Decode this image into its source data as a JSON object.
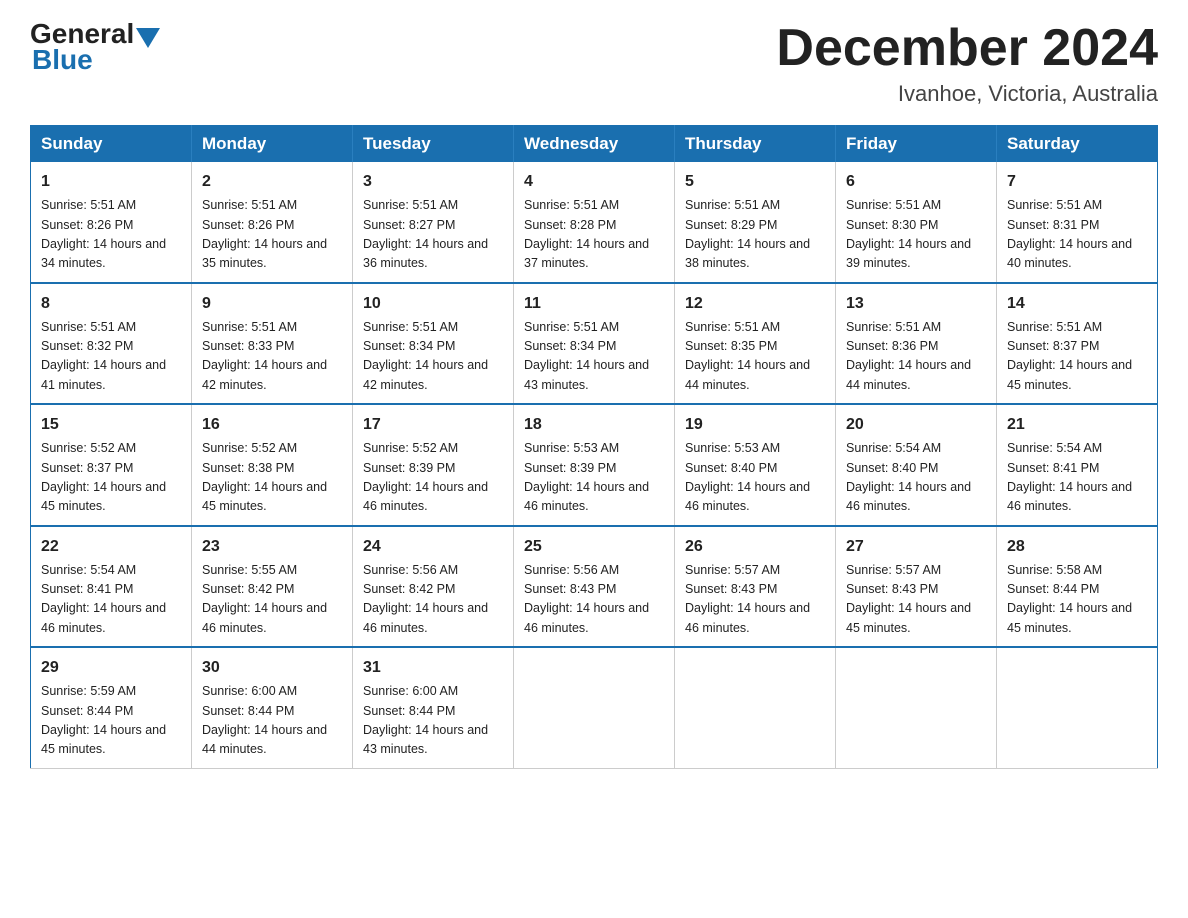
{
  "logo": {
    "general": "General",
    "blue": "Blue"
  },
  "title": "December 2024",
  "subtitle": "Ivanhoe, Victoria, Australia",
  "days_of_week": [
    "Sunday",
    "Monday",
    "Tuesday",
    "Wednesday",
    "Thursday",
    "Friday",
    "Saturday"
  ],
  "weeks": [
    [
      {
        "day": "1",
        "sunrise": "5:51 AM",
        "sunset": "8:26 PM",
        "daylight": "14 hours and 34 minutes."
      },
      {
        "day": "2",
        "sunrise": "5:51 AM",
        "sunset": "8:26 PM",
        "daylight": "14 hours and 35 minutes."
      },
      {
        "day": "3",
        "sunrise": "5:51 AM",
        "sunset": "8:27 PM",
        "daylight": "14 hours and 36 minutes."
      },
      {
        "day": "4",
        "sunrise": "5:51 AM",
        "sunset": "8:28 PM",
        "daylight": "14 hours and 37 minutes."
      },
      {
        "day": "5",
        "sunrise": "5:51 AM",
        "sunset": "8:29 PM",
        "daylight": "14 hours and 38 minutes."
      },
      {
        "day": "6",
        "sunrise": "5:51 AM",
        "sunset": "8:30 PM",
        "daylight": "14 hours and 39 minutes."
      },
      {
        "day": "7",
        "sunrise": "5:51 AM",
        "sunset": "8:31 PM",
        "daylight": "14 hours and 40 minutes."
      }
    ],
    [
      {
        "day": "8",
        "sunrise": "5:51 AM",
        "sunset": "8:32 PM",
        "daylight": "14 hours and 41 minutes."
      },
      {
        "day": "9",
        "sunrise": "5:51 AM",
        "sunset": "8:33 PM",
        "daylight": "14 hours and 42 minutes."
      },
      {
        "day": "10",
        "sunrise": "5:51 AM",
        "sunset": "8:34 PM",
        "daylight": "14 hours and 42 minutes."
      },
      {
        "day": "11",
        "sunrise": "5:51 AM",
        "sunset": "8:34 PM",
        "daylight": "14 hours and 43 minutes."
      },
      {
        "day": "12",
        "sunrise": "5:51 AM",
        "sunset": "8:35 PM",
        "daylight": "14 hours and 44 minutes."
      },
      {
        "day": "13",
        "sunrise": "5:51 AM",
        "sunset": "8:36 PM",
        "daylight": "14 hours and 44 minutes."
      },
      {
        "day": "14",
        "sunrise": "5:51 AM",
        "sunset": "8:37 PM",
        "daylight": "14 hours and 45 minutes."
      }
    ],
    [
      {
        "day": "15",
        "sunrise": "5:52 AM",
        "sunset": "8:37 PM",
        "daylight": "14 hours and 45 minutes."
      },
      {
        "day": "16",
        "sunrise": "5:52 AM",
        "sunset": "8:38 PM",
        "daylight": "14 hours and 45 minutes."
      },
      {
        "day": "17",
        "sunrise": "5:52 AM",
        "sunset": "8:39 PM",
        "daylight": "14 hours and 46 minutes."
      },
      {
        "day": "18",
        "sunrise": "5:53 AM",
        "sunset": "8:39 PM",
        "daylight": "14 hours and 46 minutes."
      },
      {
        "day": "19",
        "sunrise": "5:53 AM",
        "sunset": "8:40 PM",
        "daylight": "14 hours and 46 minutes."
      },
      {
        "day": "20",
        "sunrise": "5:54 AM",
        "sunset": "8:40 PM",
        "daylight": "14 hours and 46 minutes."
      },
      {
        "day": "21",
        "sunrise": "5:54 AM",
        "sunset": "8:41 PM",
        "daylight": "14 hours and 46 minutes."
      }
    ],
    [
      {
        "day": "22",
        "sunrise": "5:54 AM",
        "sunset": "8:41 PM",
        "daylight": "14 hours and 46 minutes."
      },
      {
        "day": "23",
        "sunrise": "5:55 AM",
        "sunset": "8:42 PM",
        "daylight": "14 hours and 46 minutes."
      },
      {
        "day": "24",
        "sunrise": "5:56 AM",
        "sunset": "8:42 PM",
        "daylight": "14 hours and 46 minutes."
      },
      {
        "day": "25",
        "sunrise": "5:56 AM",
        "sunset": "8:43 PM",
        "daylight": "14 hours and 46 minutes."
      },
      {
        "day": "26",
        "sunrise": "5:57 AM",
        "sunset": "8:43 PM",
        "daylight": "14 hours and 46 minutes."
      },
      {
        "day": "27",
        "sunrise": "5:57 AM",
        "sunset": "8:43 PM",
        "daylight": "14 hours and 45 minutes."
      },
      {
        "day": "28",
        "sunrise": "5:58 AM",
        "sunset": "8:44 PM",
        "daylight": "14 hours and 45 minutes."
      }
    ],
    [
      {
        "day": "29",
        "sunrise": "5:59 AM",
        "sunset": "8:44 PM",
        "daylight": "14 hours and 45 minutes."
      },
      {
        "day": "30",
        "sunrise": "6:00 AM",
        "sunset": "8:44 PM",
        "daylight": "14 hours and 44 minutes."
      },
      {
        "day": "31",
        "sunrise": "6:00 AM",
        "sunset": "8:44 PM",
        "daylight": "14 hours and 43 minutes."
      },
      null,
      null,
      null,
      null
    ]
  ],
  "labels": {
    "sunrise": "Sunrise:",
    "sunset": "Sunset:",
    "daylight": "Daylight:"
  }
}
